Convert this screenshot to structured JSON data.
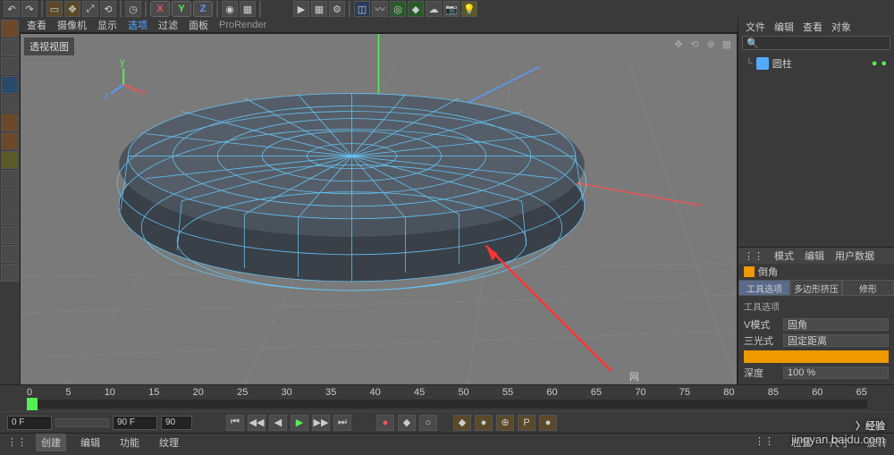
{
  "topbar": {
    "axis": {
      "x": "X",
      "y": "Y",
      "z": "Z"
    }
  },
  "view_menu": {
    "items": [
      "查看",
      "摄像机",
      "显示",
      "选项",
      "过滤",
      "面板",
      "ProRender"
    ],
    "selected_index": 3
  },
  "viewport": {
    "label": "透视视图",
    "status_text": "网",
    "nav_icons": [
      "✥",
      "⟲",
      "⊕",
      "▦"
    ]
  },
  "object_panel": {
    "menu": [
      "文件",
      "编辑",
      "查看",
      "对象"
    ],
    "search_icon": "🔍",
    "items": [
      {
        "name": "圆柱",
        "icon": "cylinder"
      }
    ]
  },
  "attr_panel": {
    "menu": [
      "模式",
      "编辑",
      "用户数据"
    ],
    "title": "倒角",
    "tabs": [
      "工具选项",
      "多边形挤压",
      "修形"
    ],
    "active_tab": 0,
    "section_label": "工具选项",
    "rows": [
      {
        "label": "V模式",
        "value": "固角"
      },
      {
        "label": "三光式",
        "value": "固定距离"
      },
      {
        "label": "深度",
        "value": "100 %"
      }
    ]
  },
  "timeline": {
    "ticks": [
      "0",
      "5",
      "10",
      "15",
      "20",
      "25",
      "30",
      "35",
      "40",
      "45",
      "50",
      "55",
      "60",
      "65",
      "70",
      "75",
      "80",
      "85",
      "60",
      "65"
    ],
    "start": "0 F",
    "end": "90 F",
    "end2": "90"
  },
  "transport": {
    "buttons": [
      "⏮",
      "◀◀",
      "◀",
      "▶",
      "▶▶",
      "⏭"
    ],
    "rec": "●",
    "keys": [
      "◆",
      "○",
      "◆",
      "●",
      "⊕",
      "P",
      "●"
    ]
  },
  "bottombar": {
    "tabs": [
      "创建",
      "编辑",
      "功能",
      "纹理"
    ],
    "coords": [
      "位置",
      "尺寸",
      "旋转"
    ]
  },
  "watermark": {
    "brand": "经验",
    "url": "jingyan.baidu.com"
  },
  "chart_data": null
}
